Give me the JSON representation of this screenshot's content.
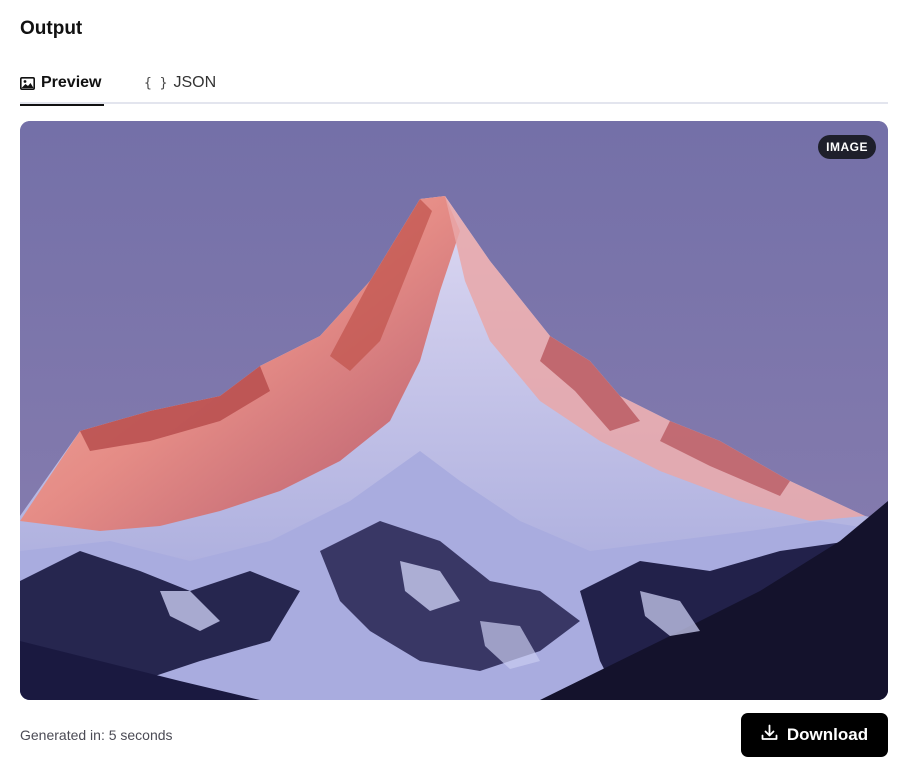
{
  "output": {
    "title": "Output",
    "tabs": [
      {
        "label": "Preview",
        "icon": "image-icon",
        "active": true
      },
      {
        "label": "JSON",
        "icon": "braces-icon",
        "active": false
      }
    ],
    "json_icon_glyph": "{ }",
    "image": {
      "badge": "IMAGE",
      "alt": "Generated image"
    },
    "generated_time": "Generated in: 5 seconds",
    "download_label": "Download",
    "colors": {
      "sky": "#7673a8",
      "alpenglow": "#e98a7f",
      "snow_shadow": "#c9ccf0",
      "rock": "#1c1b3c",
      "button": "#000000"
    }
  }
}
